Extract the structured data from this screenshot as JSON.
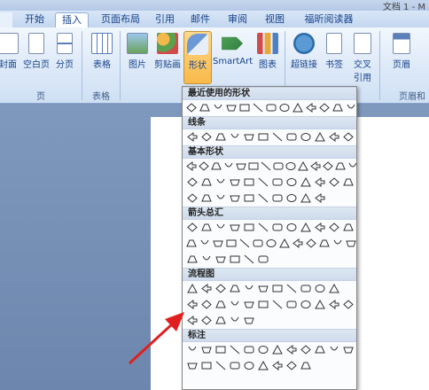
{
  "title_fragment": "文档 1 - M",
  "tabs": [
    "开始",
    "插入",
    "页面布局",
    "引用",
    "邮件",
    "审阅",
    "视图",
    "福昕阅读器"
  ],
  "active_tab": "插入",
  "ribbon": {
    "buttons": {
      "cover": "封面",
      "blank": "空白页",
      "pagebreak": "分页",
      "table": "表格",
      "picture": "图片",
      "clipart": "剪贴画",
      "shapes": "形状",
      "smartart": "SmartArt",
      "chart": "图表",
      "hyperlink": "超链接",
      "bookmark": "书签",
      "crossref": "交叉\n引用",
      "header": "页眉"
    },
    "groups": {
      "pages": "页",
      "tables": "表格",
      "headerfooter": "页眉和"
    }
  },
  "menu": {
    "sections": [
      "最近使用的形状",
      "线条",
      "基本形状",
      "箭头总汇",
      "流程图",
      "标注"
    ]
  },
  "colors": {
    "accent_pressed": "#f8b94a",
    "arrow": "#e02020",
    "ribbon_text": "#15428b"
  }
}
